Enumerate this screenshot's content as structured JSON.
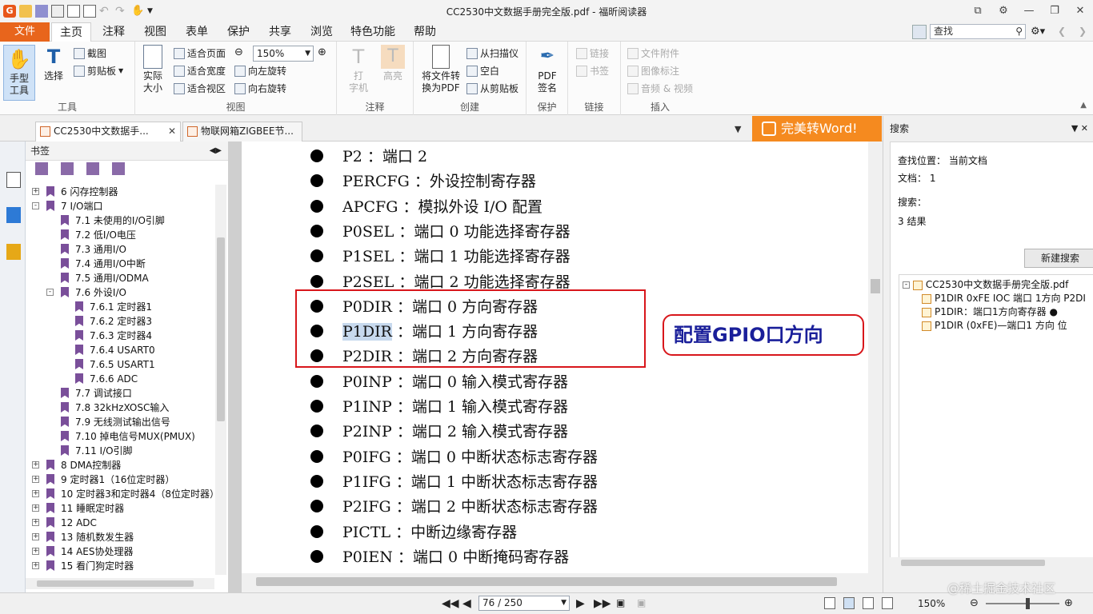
{
  "window": {
    "title": "CC2530中文数据手册完全版.pdf - 福昕阅读器",
    "app_logo": "G",
    "controls": [
      "restore-icon",
      "settings-icon",
      "minimize-icon",
      "maximize-icon",
      "close-icon"
    ]
  },
  "ribbon_tabs": {
    "file": "文件",
    "tabs": [
      "主页",
      "注释",
      "视图",
      "表单",
      "保护",
      "共享",
      "浏览",
      "特色功能",
      "帮助"
    ],
    "active": "主页",
    "search_value": "查找"
  },
  "ribbon": {
    "tools": {
      "hand": "手型\n工具",
      "select": "选择",
      "snapshot": "截图",
      "clipboard": "剪贴板",
      "label": "工具"
    },
    "view": {
      "actual_size": "实际\n大小",
      "fit_page": "适合页面",
      "fit_width": "适合宽度",
      "fit_visible": "适合视区",
      "zoom": "150%",
      "rotate_left": "向左旋转",
      "rotate_right": "向右旋转",
      "label": "视图"
    },
    "annotate": {
      "typewriter": "打\n字机",
      "highlight": "高亮",
      "label": "注释"
    },
    "create": {
      "to_pdf": "将文件转\n换为PDF",
      "from_scanner": "从扫描仪",
      "blank": "空白",
      "from_clipboard": "从剪贴板",
      "label": "创建"
    },
    "protect": {
      "sign": "PDF\n签名",
      "label": "保护"
    },
    "links": {
      "link": "链接",
      "bookmark": "书签",
      "label": "链接"
    },
    "insert": {
      "file_attach": "文件附件",
      "image_annot": "图像标注",
      "audio_video": "音频 & 视频",
      "label": "插入"
    }
  },
  "doc_tabs": [
    {
      "label": "CC2530中文数据手...",
      "closable": true
    },
    {
      "label": "物联网箱ZIGBEE节..."
    }
  ],
  "word_banner": "完美转Word!",
  "bookmarks": {
    "header": "书签",
    "items": [
      {
        "level": 0,
        "expand": "+",
        "text": "6  闪存控制器"
      },
      {
        "level": 0,
        "expand": "-",
        "text": "7  I/O端口"
      },
      {
        "level": 1,
        "text": "7.1  未使用的I/O引脚"
      },
      {
        "level": 1,
        "text": "7.2  低I/O电压"
      },
      {
        "level": 1,
        "text": "7.3  通用I/O"
      },
      {
        "level": 1,
        "text": "7.4  通用I/O中断"
      },
      {
        "level": 1,
        "text": "7.5  通用I/ODMA"
      },
      {
        "level": 1,
        "expand": "-",
        "text": "7.6  外设I/O"
      },
      {
        "level": 2,
        "text": "7.6.1  定时器1"
      },
      {
        "level": 2,
        "text": "7.6.2  定时器3"
      },
      {
        "level": 2,
        "text": "7.6.3  定时器4"
      },
      {
        "level": 2,
        "text": "7.6.4  USART0"
      },
      {
        "level": 2,
        "text": "7.6.5  USART1"
      },
      {
        "level": 2,
        "text": "7.6.6  ADC"
      },
      {
        "level": 1,
        "text": "7.7  调试接口"
      },
      {
        "level": 1,
        "text": "7.8  32kHzXOSC输入"
      },
      {
        "level": 1,
        "text": "7.9  无线测试输出信号"
      },
      {
        "level": 1,
        "text": "7.10  掉电信号MUX(PMUX)"
      },
      {
        "level": 1,
        "text": "7.11  I/O引脚"
      },
      {
        "level": 0,
        "expand": "+",
        "text": "8  DMA控制器"
      },
      {
        "level": 0,
        "expand": "+",
        "text": "9  定时器1（16位定时器）"
      },
      {
        "level": 0,
        "expand": "+",
        "text": "10  定时器3和定时器4（8位定时器）"
      },
      {
        "level": 0,
        "expand": "+",
        "text": "11  睡眠定时器"
      },
      {
        "level": 0,
        "expand": "+",
        "text": "12  ADC"
      },
      {
        "level": 0,
        "expand": "+",
        "text": "13  随机数发生器"
      },
      {
        "level": 0,
        "expand": "+",
        "text": "14  AES协处理器"
      },
      {
        "level": 0,
        "expand": "+",
        "text": "15  看门狗定时器"
      }
    ]
  },
  "document": {
    "lines": [
      {
        "reg": "P2 ：端口 2"
      },
      {
        "reg": "PERCFG ：外设控制寄存器"
      },
      {
        "reg": "APCFG  ：模拟外设 I/O 配置"
      },
      {
        "reg": "P0SEL ：端口 0 功能选择寄存器"
      },
      {
        "reg": "P1SEL ：端口 1 功能选择寄存器"
      },
      {
        "reg": "P2SEL ：端口 2 功能选择寄存器"
      },
      {
        "reg": "P0DIR ：端口 0 方向寄存器"
      },
      {
        "reg": "P1DIR",
        "rest": " ：端口 1 方向寄存器",
        "highlight": true
      },
      {
        "reg": "P2DIR ：端口 2 方向寄存器"
      },
      {
        "reg": "P0INP ：端口 0 输入模式寄存器"
      },
      {
        "reg": "P1INP ：端口 1 输入模式寄存器"
      },
      {
        "reg": "P2INP ：端口 2 输入模式寄存器"
      },
      {
        "reg": "P0IFG ：端口 0 中断状态标志寄存器"
      },
      {
        "reg": "P1IFG ：端口 1 中断状态标志寄存器"
      },
      {
        "reg": "P2IFG ：端口 2 中断状态标志寄存器"
      },
      {
        "reg": "PICTL ：中断边缘寄存器"
      },
      {
        "reg": "P0IEN ：端口 0 中断掩码寄存器"
      }
    ],
    "callout": "配置GPIO口方向"
  },
  "search_panel": {
    "header": "搜索",
    "location_label": "查找位置：",
    "location_value": "当前文档",
    "docs_label": "文档：",
    "docs_value": "1",
    "search_label": "搜索：",
    "results_count": "3 结果",
    "new_search": "新建搜索",
    "results": [
      "CC2530中文数据手册完全版.pdf",
      "P1DIR 0xFE IOC 端口 1方向 P2DI",
      "P1DIR：端口1方向寄存器 ●",
      "P1DIR (0xFE)—端口1 方向 位"
    ]
  },
  "status": {
    "page": "76 / 250",
    "zoom": "150%",
    "zoom_level": 0.57,
    "watermark": "@稀土掘金技术社区"
  }
}
